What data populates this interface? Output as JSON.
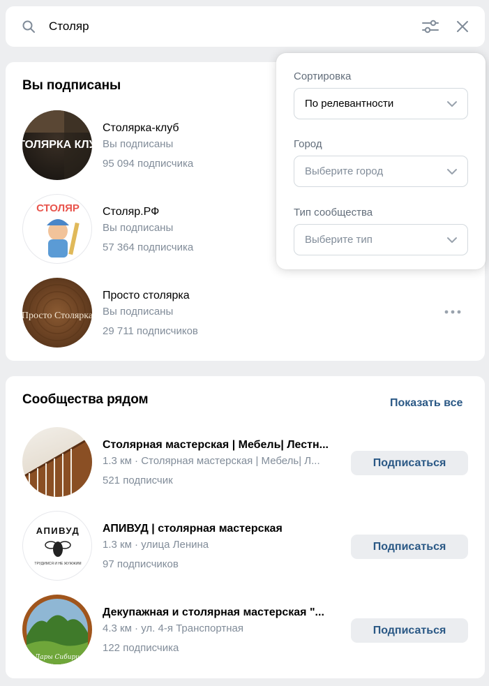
{
  "search": {
    "query": "Столяр"
  },
  "subscribed": {
    "title": "Вы подписаны",
    "items": [
      {
        "name": "Столярка-клуб",
        "status": "Вы подписаны",
        "members": "95 094 подписчика",
        "avatar_text": "СТОЛЯРКА КЛУБ"
      },
      {
        "name": "Столяр.РФ",
        "status": "Вы подписаны",
        "members": "57 364 подписчика",
        "avatar_text": "СТОЛЯР"
      },
      {
        "name": "Просто столярка",
        "status": "Вы подписаны",
        "members": "29 711 подписчиков",
        "avatar_text": "Просто Столярка"
      }
    ]
  },
  "nearby": {
    "title": "Сообщества рядом",
    "show_all": "Показать все",
    "subscribe_label": "Подписаться",
    "items": [
      {
        "name": "Столярная мастерская | Мебель| Лестн...",
        "info": "1.3 км · Столярная мастерская | Мебель| Л...",
        "members": "521 подписчик"
      },
      {
        "name": "АПИВУД | столярная мастерская",
        "info": "1.3 км · улица Ленина",
        "members": "97 подписчиков",
        "avatar_text": "АПИВУД",
        "avatar_caption": "ТРУДИМСЯ И НЕ ЖУЖЖИМ"
      },
      {
        "name": "Декупажная и столярная мастерская \"...",
        "info": "4.3 км · ул. 4-я Транспортная",
        "members": "122 подписчика",
        "avatar_text": "Дары Сибири"
      }
    ]
  },
  "filters": {
    "sort_label": "Сортировка",
    "sort_value": "По релевантности",
    "city_label": "Город",
    "city_placeholder": "Выберите город",
    "type_label": "Тип сообщества",
    "type_placeholder": "Выберите тип"
  },
  "colors": {
    "accent": "#2a5885",
    "muted": "#818c99",
    "background": "#edeef0"
  }
}
